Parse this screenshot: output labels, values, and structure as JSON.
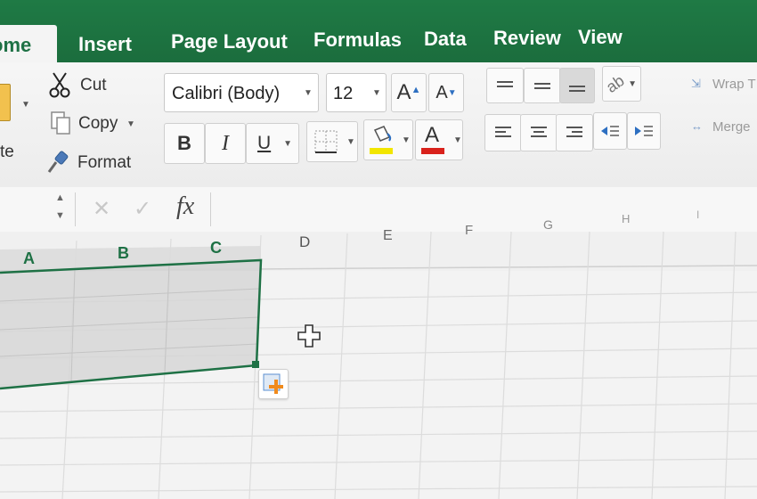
{
  "tabs": [
    {
      "label": "ome",
      "active": true
    },
    {
      "label": "Insert"
    },
    {
      "label": "Page Layout"
    },
    {
      "label": "Formulas"
    },
    {
      "label": "Data"
    },
    {
      "label": "Review"
    },
    {
      "label": "View"
    }
  ],
  "clipboard": {
    "paste_label": "te",
    "cut_label": "Cut",
    "copy_label": "Copy",
    "format_label": "Format"
  },
  "font": {
    "family": "Calibri (Body)",
    "size": "12",
    "grow_label": "A",
    "shrink_label": "A",
    "bold_label": "B",
    "italic_label": "I",
    "underline_label": "U",
    "highlight_color": "#f2e600",
    "font_color": "#d9221c",
    "font_color_label": "A"
  },
  "alignment": {
    "wrap_label": "Wrap T",
    "merge_label": "Merge"
  },
  "formula_bar": {
    "fx_label": "fx",
    "cancel_label": "✕",
    "enter_label": "✓"
  },
  "columns": [
    "A",
    "B",
    "C",
    "D",
    "E",
    "F",
    "G",
    "H",
    "I"
  ],
  "colors": {
    "brand_green": "#1e7145",
    "ribbon_bg": "#f3f3f3",
    "selection_fill": "#d6d6d6"
  }
}
